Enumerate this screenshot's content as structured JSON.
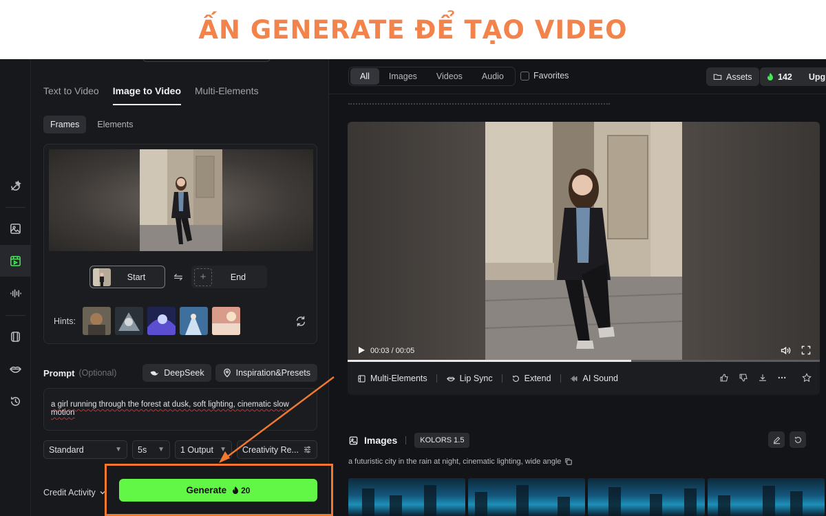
{
  "banner": {
    "title": "ẤN GENERATE ĐỂ TẠO VIDEO",
    "color": "#f2834a"
  },
  "rail": {
    "items": [
      {
        "name": "magic-tool-icon"
      },
      {
        "name": "image-icon"
      },
      {
        "name": "video-icon",
        "active": true
      },
      {
        "name": "audio-wave-icon"
      },
      {
        "name": "frame-icon"
      },
      {
        "name": "lips-icon"
      },
      {
        "name": "history-icon"
      }
    ],
    "accent": "#4ae55a"
  },
  "left_panel": {
    "tabs": [
      {
        "label": "Text to Video"
      },
      {
        "label": "Image to Video",
        "active": true
      },
      {
        "label": "Multi-Elements"
      }
    ],
    "subtabs": [
      {
        "label": "Frames",
        "active": true
      },
      {
        "label": "Elements"
      }
    ],
    "frames": {
      "start_label": "Start",
      "end_label": "End",
      "end_plus": "+"
    },
    "hints": {
      "label": "Hints:",
      "count": 5
    },
    "prompt": {
      "title": "Prompt",
      "optional": "(Optional)",
      "deepseek_label": "DeepSeek",
      "inspiration_label": "Inspiration&Presets",
      "text": "a girl running through the forest at dusk, soft lighting, cinematic slow motion"
    },
    "settings": {
      "mode": "Standard",
      "duration": "5s",
      "outputs": "1 Output",
      "creativity": "Creativity Re..."
    },
    "bottom": {
      "credit_label": "Credit Activity",
      "generate_label": "Generate",
      "generate_cost": "20",
      "generate_color": "#62f646"
    }
  },
  "right_panel": {
    "filters": [
      {
        "label": "All",
        "active": true
      },
      {
        "label": "Images"
      },
      {
        "label": "Videos"
      },
      {
        "label": "Audio"
      }
    ],
    "favorites_label": "Favorites",
    "assets_label": "Assets",
    "credits_value": "142",
    "upgrade_label": "Upg",
    "video": {
      "time": "00:03 / 00:05",
      "progress": 0.6
    },
    "actions": [
      {
        "label": "Multi-Elements"
      },
      {
        "label": "Lip Sync"
      },
      {
        "label": "Extend"
      },
      {
        "label": "AI Sound"
      }
    ],
    "images": {
      "title": "Images",
      "model": "KOLORS 1.5",
      "prompt": "a futuristic city in the rain at night, cinematic lighting, wide angle"
    }
  },
  "annotation": {
    "color": "#f2782f"
  }
}
